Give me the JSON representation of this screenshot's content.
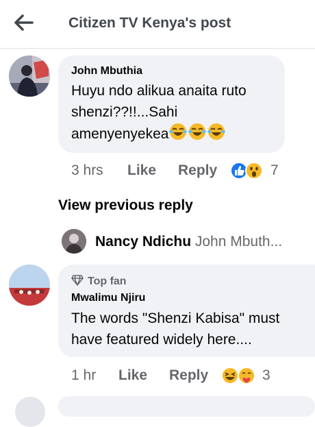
{
  "header": {
    "title": "Citizen TV Kenya's post"
  },
  "comments": [
    {
      "author": "John Mbuthia",
      "text": "Huyu ndo alikua anaita ruto shenzi??!!...Sahi amenyenyekea",
      "emoji_suffix": [
        "laughing-tears",
        "laughing-tears",
        "laughing-tears"
      ],
      "time": "3 hrs",
      "like_label": "Like",
      "reply_label": "Reply",
      "reactions": [
        "like",
        "wow"
      ],
      "reaction_count": "7"
    },
    {
      "badge": "Top fan",
      "author": "Mwalimu Njiru",
      "text": "The words \"Shenzi Kabisa\" must have featured widely here....",
      "time": "1 hr",
      "like_label": "Like",
      "reply_label": "Reply",
      "reactions": [
        "haha",
        "care"
      ],
      "reaction_count": "3"
    }
  ],
  "view_previous": "View previous reply",
  "reply_preview": {
    "author": "Nancy Ndichu",
    "text": "John Mbuth..."
  },
  "colors": {
    "bubble": "#f0f2f5",
    "meta": "#65676b",
    "like_blue": "#1877f2",
    "reaction_yellow": "#f7b928"
  }
}
